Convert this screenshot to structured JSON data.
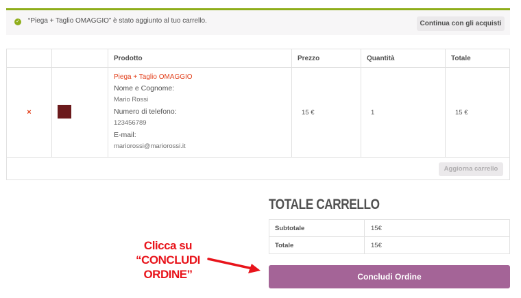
{
  "notice": {
    "message": "“Piega + Taglio OMAGGIO” è stato aggiunto al tuo carrello.",
    "continue_label": "Continua con gli acquisti",
    "accent_color": "#8fae1b"
  },
  "cart": {
    "headers": {
      "product": "Prodotto",
      "price": "Prezzo",
      "quantity": "Quantità",
      "total": "Totale"
    },
    "item": {
      "remove_symbol": "×",
      "product_name": "Piega + Taglio OMAGGIO",
      "fields": [
        {
          "label": "Nome e Cognome:",
          "value": "Mario Rossi"
        },
        {
          "label": "Numero di telefono:",
          "value": "123456789"
        },
        {
          "label": "E-mail:",
          "value": "mariorossi@mariorossi.it"
        }
      ],
      "price": "15 €",
      "quantity": "1",
      "total": "15 €"
    },
    "update_label": "Aggiorna carrello"
  },
  "totals": {
    "title": "TOTALE CARRELLO",
    "subtotal_label": "Subtotale",
    "subtotal_value": "15€",
    "total_label": "Totale",
    "total_value": "15€",
    "checkout_label": "Concludi Ordine",
    "checkout_color": "#a46497"
  },
  "callout": {
    "line1": "Clicca su",
    "line2": "“CONCLUDI",
    "line3": "ORDINE”",
    "color": "#e8141b"
  }
}
